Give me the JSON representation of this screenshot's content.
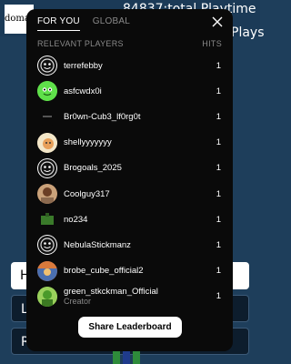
{
  "background": {
    "logo_text": "doma!",
    "playtime_text": "84837:total Playtime",
    "plays_text": "Plays",
    "buttons": [
      "H",
      "L",
      "R"
    ]
  },
  "modal": {
    "tabs": [
      {
        "label": "FOR YOU",
        "active": true
      },
      {
        "label": "GLOBAL",
        "active": false
      }
    ],
    "column_players": "RELEVANT PLAYERS",
    "column_hits": "HITS",
    "players": [
      {
        "name": "terrefebby",
        "hits": "1",
        "avatar": "roblox-face-icon"
      },
      {
        "name": "asfcwdx0i",
        "hits": "1",
        "avatar": "green-face-icon"
      },
      {
        "name": "Br0wn-Cub3_lf0rg0t",
        "hits": "1",
        "avatar": "blank-dark-icon"
      },
      {
        "name": "shellyyyyyyy",
        "hits": "1",
        "avatar": "cream-face-icon"
      },
      {
        "name": "Brogoals_2025",
        "hits": "1",
        "avatar": "roblox-face-icon"
      },
      {
        "name": "Coolguy317",
        "hits": "1",
        "avatar": "photo-avatar-icon"
      },
      {
        "name": "no234",
        "hits": "1",
        "avatar": "green-block-icon"
      },
      {
        "name": "NebulaStickmanz",
        "hits": "1",
        "avatar": "roblox-face-icon"
      },
      {
        "name": "brobe_cube_official2",
        "hits": "1",
        "avatar": "colorful-avatar-icon"
      },
      {
        "name": "green_stkckman_Official",
        "subtitle": "Creator",
        "hits": "1",
        "avatar": "green-creator-icon"
      }
    ],
    "share_label": "Share Leaderboard"
  },
  "colors": {
    "modal_bg": "#0a0a0a",
    "page_bg": "#1e3e5b",
    "muted_text": "#8a8a8a"
  }
}
